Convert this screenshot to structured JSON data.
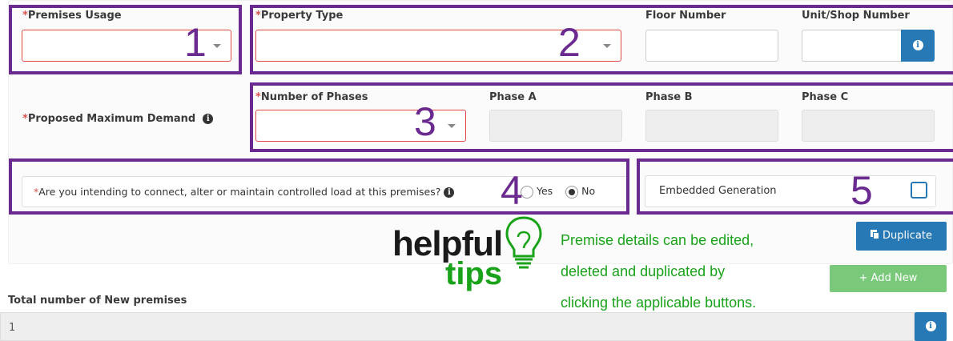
{
  "form": {
    "premises_usage": {
      "label": "Premises Usage",
      "required_mark": "*",
      "value": ""
    },
    "property_type": {
      "label": "Property Type",
      "required_mark": "*",
      "value": ""
    },
    "floor_number": {
      "label": "Floor Number",
      "value": ""
    },
    "unit_shop_number": {
      "label": "Unit/Shop Number",
      "value": ""
    },
    "proposed_max_demand": {
      "label": "Proposed Maximum Demand",
      "required_mark": "*"
    },
    "number_of_phases": {
      "label": "Number of Phases",
      "required_mark": "*",
      "value": ""
    },
    "phase_a": {
      "label": "Phase A",
      "value": ""
    },
    "phase_b": {
      "label": "Phase B",
      "value": ""
    },
    "phase_c": {
      "label": "Phase C",
      "value": ""
    },
    "controlled_load": {
      "required_mark": "*",
      "question": "Are you intending to connect, alter or maintain controlled load at this premises?",
      "option_yes": "Yes",
      "option_no": "No",
      "selected": "No"
    },
    "embedded_generation": {
      "label": "Embedded Generation",
      "checked": false
    },
    "duplicate_label": "Duplicate",
    "add_new_label": "+ Add New",
    "total_new_premises": {
      "label": "Total number of New premises",
      "value": "1"
    }
  },
  "annotations": {
    "numbers": [
      "1",
      "2",
      "3",
      "4",
      "5"
    ],
    "color": "#6b2a8f"
  },
  "tips": {
    "logo_word_1": "helpful",
    "logo_word_2": "tips",
    "line1": "Premise details can be edited,",
    "line2": "deleted and duplicated by",
    "line3": "clicking the applicable buttons."
  },
  "colors": {
    "primary": "#2679b5",
    "success": "#7ac87a",
    "error": "#e04848",
    "tip_green": "#1aa31a"
  }
}
